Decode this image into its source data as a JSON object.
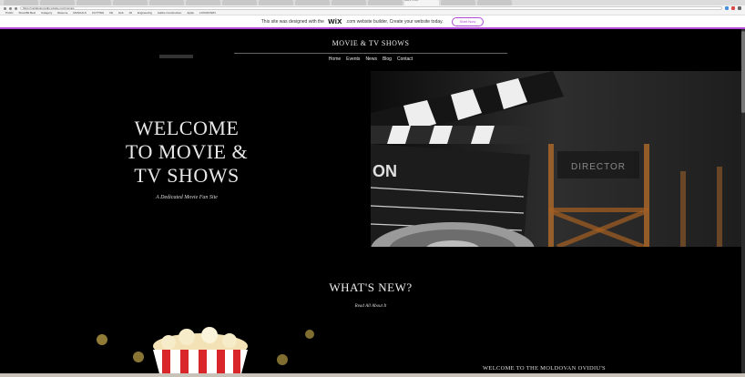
{
  "browser": {
    "tabs": [
      "",
      "",
      "",
      "",
      "",
      "",
      "",
      "",
      "",
      "",
      "",
      "Movie & TV Sho...",
      "",
      ""
    ],
    "active_tab_index": 11,
    "url": "https://moldovanovidiu.wixsite.com/movies"
  },
  "bookmarks": [
    "ProDJ",
    "Xbox360 Best",
    "Category",
    "Resume",
    "MANUALS",
    "CUTTING",
    "FE",
    "Hub",
    "All",
    "Engineering",
    "Adobe Construction",
    "Apple",
    "LOCKDOWN"
  ],
  "banner": {
    "text_before": "This site was designed with the",
    "logo": "WiX",
    "text_after": ".com website builder. Create your website today.",
    "cta": "Start Now"
  },
  "site": {
    "title": "MOVIE & TV SHOWS",
    "nav": [
      "Home",
      "Events",
      "News",
      "Blog",
      "Contact"
    ]
  },
  "hero": {
    "heading_line1": "WELCOME",
    "heading_line2": "TO MOVIE &",
    "heading_line3": "TV SHOWS",
    "subtitle": "A Dedicated Movie Fan Site",
    "image_chair_text": "DIRECTOR",
    "image_clapper_text": "ON"
  },
  "section": {
    "heading": "WHAT'S NEW?",
    "subheading": "Read All About It",
    "bottom_text": "WELCOME TO THE MOLDOVAN OVIDIU'S"
  },
  "colors": {
    "background": "#000000",
    "wix_accent": "#b14ad4"
  }
}
